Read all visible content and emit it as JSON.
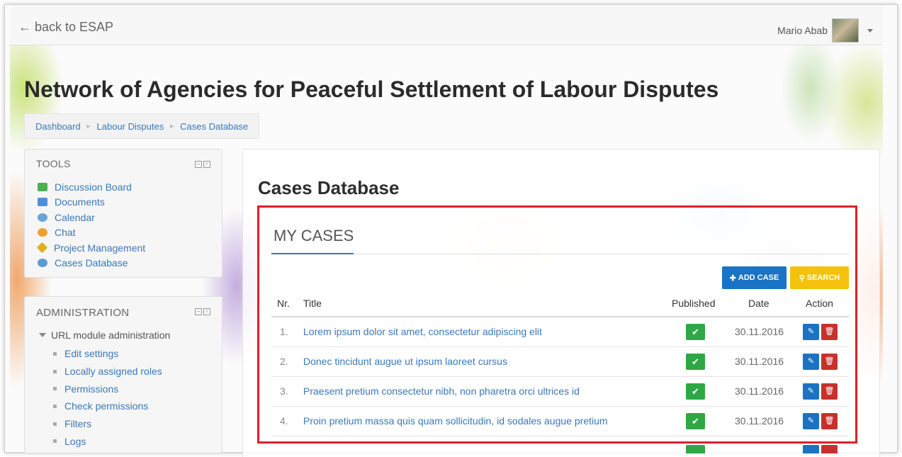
{
  "navbar": {
    "back_link": "← back to ESAP",
    "user_name": "Mario Abab"
  },
  "page": {
    "title": "Network of Agencies for Peaceful Settlement of Labour Disputes"
  },
  "breadcrumb": {
    "items": [
      "Dashboard",
      "Labour Disputes",
      "Cases Database"
    ],
    "separator": "►"
  },
  "tools_block": {
    "header": "TOOLS",
    "items": [
      {
        "label": "Discussion Board",
        "icon": "discussion-board-icon",
        "color": "#4caf50"
      },
      {
        "label": "Documents",
        "icon": "folder-icon",
        "color": "#4f8fd8"
      },
      {
        "label": "Calendar",
        "icon": "calendar-icon",
        "color": "#6ba5d8"
      },
      {
        "label": "Chat",
        "icon": "chat-icon",
        "color": "#f0a030"
      },
      {
        "label": "Project Management",
        "icon": "project-management-icon",
        "color": "#e0b020"
      },
      {
        "label": "Cases Database",
        "icon": "cases-database-icon",
        "color": "#5b9bd5"
      }
    ]
  },
  "admin_block": {
    "header": "ADMINISTRATION",
    "node": "URL module administration",
    "items": [
      "Edit settings",
      "Locally assigned roles",
      "Permissions",
      "Check permissions",
      "Filters",
      "Logs"
    ]
  },
  "main": {
    "section_title": "Cases Database",
    "panel_title": "MY CASES",
    "add_button": "ADD CASE",
    "search_button": "SEARCH",
    "columns": [
      "Nr.",
      "Title",
      "Published",
      "Date",
      "Action"
    ],
    "rows": [
      {
        "nr": "1.",
        "title": "Lorem ipsum dolor sit amet, consectetur adipiscing elit",
        "published": true,
        "date": "30.11.2016"
      },
      {
        "nr": "2.",
        "title": "Donec tincidunt augue ut ipsum laoreet cursus",
        "published": true,
        "date": "30.11.2016"
      },
      {
        "nr": "3.",
        "title": "Praesent pretium consectetur nibh, non pharetra orci ultrices id",
        "published": true,
        "date": "30.11.2016"
      },
      {
        "nr": "4.",
        "title": "Proin pretium massa quis quam sollicitudin, id sodales augue pretium",
        "published": true,
        "date": "30.11.2016"
      }
    ]
  },
  "colors": {
    "link": "#3a78b8",
    "highlight_frame": "#e0202a",
    "add_button": "#1a73c4",
    "search_button": "#f4c20d",
    "published": "#2ea844",
    "delete": "#c9302c"
  }
}
